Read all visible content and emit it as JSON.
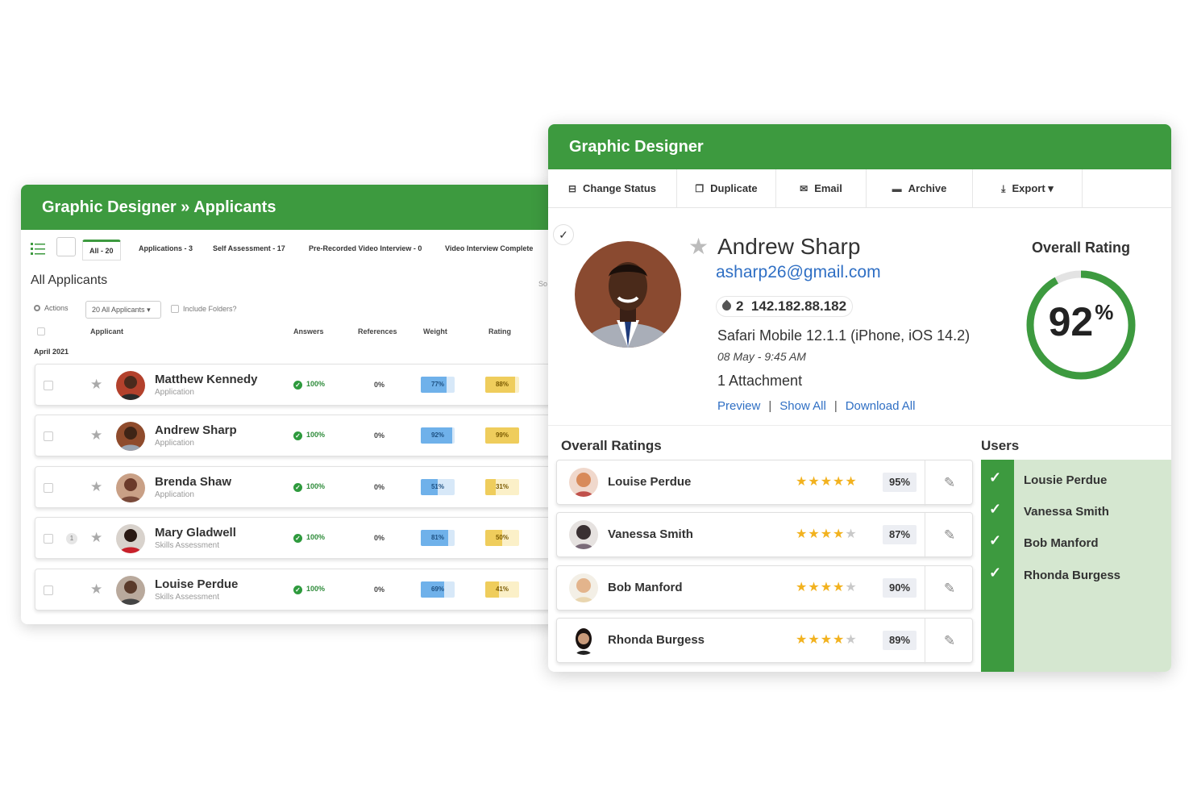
{
  "colors": {
    "brand_green": "#3d9a3f",
    "link_blue": "#2f6fc4",
    "star_gold": "#f2b21f",
    "weight_blue": "#6fb1ea",
    "rating_yellow": "#efcd5c",
    "users_bg": "#d5e7d0"
  },
  "left": {
    "title": "Graphic Designer » Applicants",
    "tabs": [
      "All - 20",
      "Applications - 3",
      "Self Assessment - 17",
      "Pre-Recorded Video Interview - 0",
      "Video Interview Complete"
    ],
    "heading": "All Applicants",
    "search_partial": "So",
    "actions_label": "Actions",
    "filter_value": "20 All Applicants",
    "include_folders": "Include Folders?",
    "columns": {
      "applicant": "Applicant",
      "answers": "Answers",
      "references": "References",
      "weight": "Weight",
      "rating": "Rating"
    },
    "month": "April 2021",
    "applicants": [
      {
        "name": "Matthew Kennedy",
        "stage": "Application",
        "answers": "100%",
        "references": "0%",
        "weight": "77%",
        "weight_value": 0.77,
        "rating": "88%",
        "rating_value": 0.88,
        "badge": ""
      },
      {
        "name": "Andrew Sharp",
        "stage": "Application",
        "answers": "100%",
        "references": "0%",
        "weight": "92%",
        "weight_value": 0.92,
        "rating": "99%",
        "rating_value": 0.99,
        "badge": ""
      },
      {
        "name": "Brenda Shaw",
        "stage": "Application",
        "answers": "100%",
        "references": "0%",
        "weight": "51%",
        "weight_value": 0.51,
        "rating": "31%",
        "rating_value": 0.31,
        "badge": ""
      },
      {
        "name": "Mary Gladwell",
        "stage": "Skills Assessment",
        "answers": "100%",
        "references": "0%",
        "weight": "81%",
        "weight_value": 0.81,
        "rating": "50%",
        "rating_value": 0.5,
        "badge": "1"
      },
      {
        "name": "Louise Perdue",
        "stage": "Skills Assessment",
        "answers": "100%",
        "references": "0%",
        "weight": "69%",
        "weight_value": 0.69,
        "rating": "41%",
        "rating_value": 0.41,
        "badge": ""
      }
    ]
  },
  "right": {
    "title": "Graphic Designer",
    "toolbar": {
      "change_status": "Change Status",
      "duplicate": "Duplicate",
      "email": "Email",
      "archive": "Archive",
      "export": "Export"
    },
    "profile": {
      "name": "Andrew Sharp",
      "email": "asharp26@gmail.com",
      "ip_count": "2",
      "ip": "142.182.88.182",
      "browser": "Safari Mobile 12.1.1 (iPhone, iOS 14.2)",
      "date": "08 May - 9:45 AM",
      "attachments": "1 Attachment",
      "links": {
        "preview": "Preview",
        "show_all": "Show All",
        "download_all": "Download All",
        "separator": "|"
      }
    },
    "overall_rating": {
      "label": "Overall Rating",
      "value": "92",
      "unit": "%",
      "fraction": 0.92
    },
    "ratings_title": "Overall Ratings",
    "ratings": [
      {
        "name": "Louise Perdue",
        "stars": 5,
        "score": "95%"
      },
      {
        "name": "Vanessa Smith",
        "stars": 4,
        "score": "87%"
      },
      {
        "name": "Bob Manford",
        "stars": 4,
        "score": "90%"
      },
      {
        "name": "Rhonda Burgess",
        "stars": 4,
        "score": "89%"
      }
    ],
    "users_title": "Users",
    "users": [
      "Lousie Perdue",
      "Vanessa Smith",
      "Bob Manford",
      "Rhonda Burgess"
    ]
  }
}
